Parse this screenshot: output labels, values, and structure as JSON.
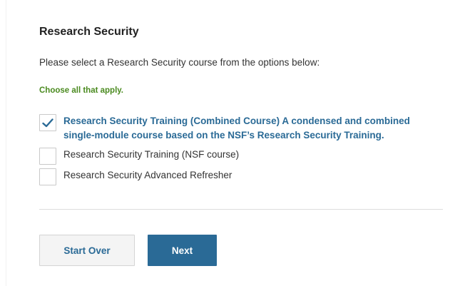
{
  "section": {
    "title": "Research Security",
    "prompt": "Please select a Research Security course from the options below:",
    "hint": "Choose all that apply."
  },
  "options": [
    {
      "label": "Research Security Training (Combined Course) A condensed and combined single-module course based on the NSF’s Research Security Training.",
      "checked": true
    },
    {
      "label": "Research Security Training (NSF course)",
      "checked": false
    },
    {
      "label": "Research Security Advanced Refresher",
      "checked": false
    }
  ],
  "buttons": {
    "start_over": "Start Over",
    "next": "Next"
  },
  "icons": {
    "checkmark": "check-icon"
  },
  "colors": {
    "accent": "#2a6a96",
    "hint": "#4a8a1f",
    "checkmark": "#2a6a96"
  }
}
